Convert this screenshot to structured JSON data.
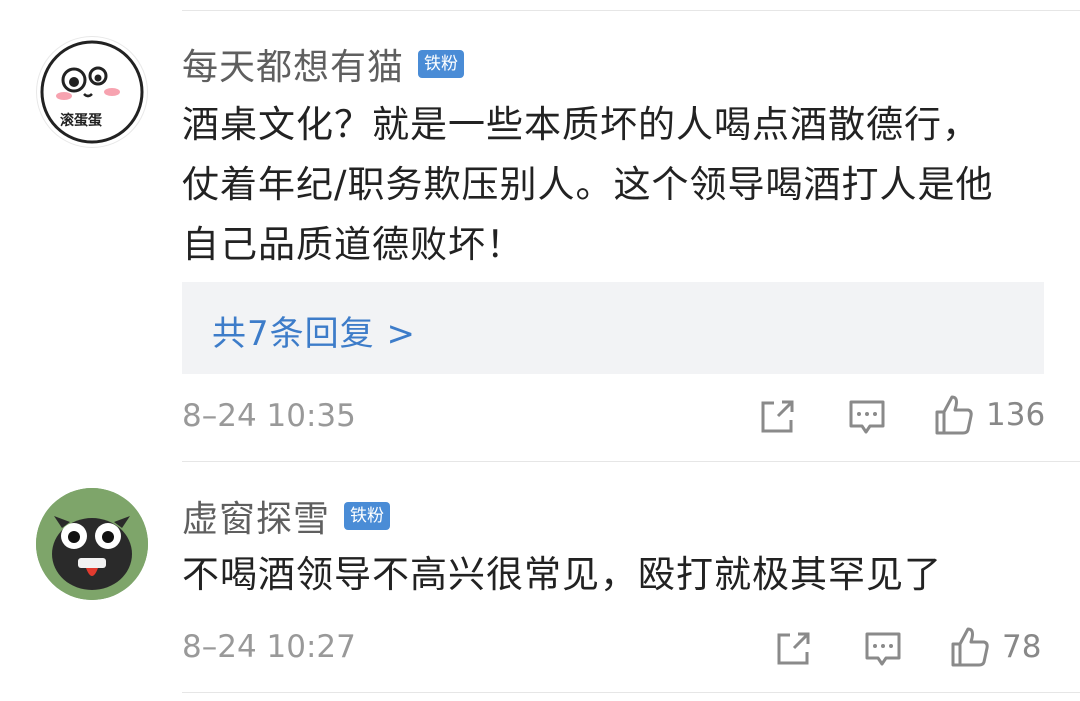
{
  "comments": [
    {
      "username": "每天都想有猫",
      "badge": "铁粉",
      "avatar_text": "滚蛋蛋",
      "avatar_icon": "cartoon-face-icon",
      "text_lines": [
        "酒桌文化？就是一些本质坏的人喝点酒散德行，",
        "仗着年纪/职务欺压别人。这个领导喝酒打人是他",
        "自己品质道德败坏！"
      ],
      "replies_label": "共7条回复 >",
      "time": "8–24 10:35",
      "likes": "136"
    },
    {
      "username": "虚窗探雪",
      "badge": "铁粉",
      "avatar_icon": "toy-figure-icon",
      "text_lines": [
        "不喝酒领导不高兴很常见，殴打就极其罕见了"
      ],
      "time": "8–24 10:27",
      "likes": "78"
    }
  ],
  "colors": {
    "badge": "#4a8cd6",
    "link": "#3d7cc9",
    "replies_bg": "#f2f3f5",
    "meta": "#999999"
  },
  "icons": [
    "share-icon",
    "reply-icon",
    "like-icon"
  ]
}
